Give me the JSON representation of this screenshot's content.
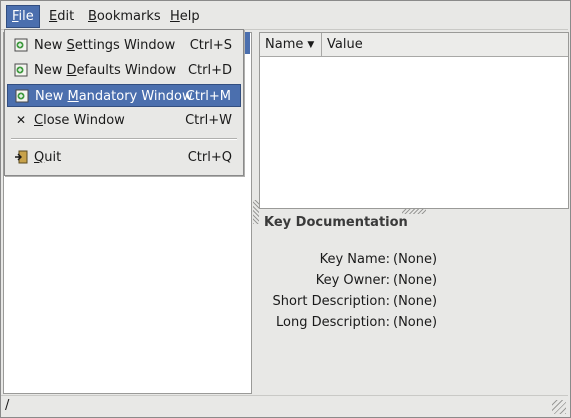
{
  "menubar": {
    "file": {
      "pre": "",
      "u": "F",
      "post": "ile"
    },
    "edit": {
      "pre": "",
      "u": "E",
      "post": "dit"
    },
    "bookmarks": {
      "pre": "",
      "u": "B",
      "post": "ookmarks"
    },
    "help": {
      "pre": "",
      "u": "H",
      "post": "elp"
    }
  },
  "file_menu": {
    "items": [
      {
        "pre": "New ",
        "u": "S",
        "post": "ettings Window",
        "shortcut": "Ctrl+S",
        "icon": "new-window-icon"
      },
      {
        "pre": "New ",
        "u": "D",
        "post": "efaults Window",
        "shortcut": "Ctrl+D",
        "icon": "new-window-icon"
      },
      {
        "pre": "New ",
        "u": "M",
        "post": "andatory Window",
        "shortcut": "Ctrl+M",
        "icon": "new-window-icon",
        "active": true
      },
      {
        "pre": "",
        "u": "C",
        "post": "lose Window",
        "shortcut": "Ctrl+W",
        "icon": "close-icon"
      },
      {
        "pre": "",
        "u": "Q",
        "post": "uit",
        "shortcut": "Ctrl+Q",
        "icon": "quit-icon"
      }
    ]
  },
  "tree": {
    "col_name": "Name",
    "col_value": "Value"
  },
  "doc": {
    "title": "Key Documentation",
    "rows": [
      {
        "label": "Key Name:",
        "value": "(None)"
      },
      {
        "label": "Key Owner:",
        "value": "(None)"
      },
      {
        "label": "Short Description:",
        "value": "(None)"
      },
      {
        "label": "Long Description:",
        "value": "(None)"
      }
    ]
  },
  "status": {
    "text": "/"
  },
  "colors": {
    "accent": "#4b6fae",
    "background": "#e8e8e6"
  }
}
